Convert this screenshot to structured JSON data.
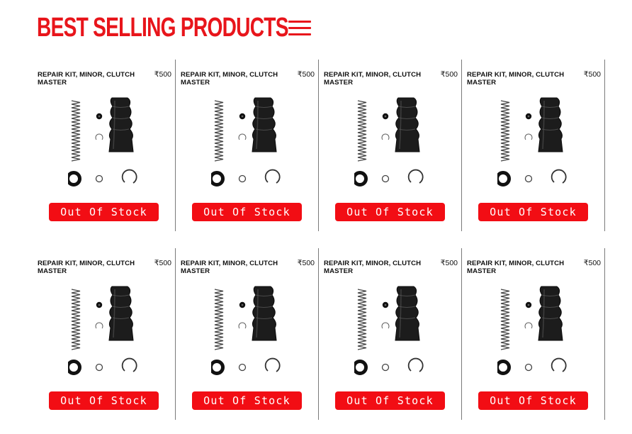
{
  "page": {
    "title": "BEST SELLING PRODUCTS",
    "menu_icon": "hamburger-menu-icon"
  },
  "colors": {
    "accent": "#e8151b",
    "button": "#f20d14",
    "divider": "#7a7a7a"
  },
  "products": [
    {
      "name": "REPAIR KIT, MINOR, CLUTCH MASTER",
      "price": "₹500",
      "status": "Out Of Stock"
    },
    {
      "name": "REPAIR KIT, MINOR, CLUTCH MASTER",
      "price": "₹500",
      "status": "Out Of Stock"
    },
    {
      "name": "REPAIR KIT, MINOR, CLUTCH MASTER",
      "price": "₹500",
      "status": "Out Of Stock"
    },
    {
      "name": "REPAIR KIT, MINOR, CLUTCH MASTER",
      "price": "₹500",
      "status": "Out Of Stock"
    },
    {
      "name": "REPAIR KIT, MINOR, CLUTCH MASTER",
      "price": "₹500",
      "status": "Out Of Stock"
    },
    {
      "name": "REPAIR KIT, MINOR, CLUTCH MASTER",
      "price": "₹500",
      "status": "Out Of Stock"
    },
    {
      "name": "REPAIR KIT, MINOR, CLUTCH MASTER",
      "price": "₹500",
      "status": "Out Of Stock"
    },
    {
      "name": "REPAIR KIT, MINOR, CLUTCH MASTER",
      "price": "₹500",
      "status": "Out Of Stock"
    }
  ]
}
